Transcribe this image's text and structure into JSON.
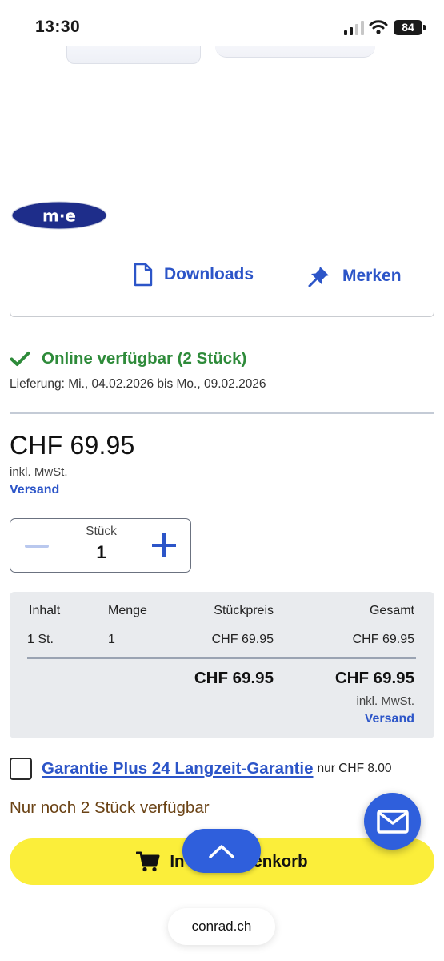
{
  "status_bar": {
    "time": "13:30",
    "battery": "84"
  },
  "product_card": {
    "brand_logo_icon": "m-e-logo",
    "downloads_label": "Downloads",
    "merken_label": "Merken"
  },
  "availability": {
    "status": "Online verfügbar (2 Stück)",
    "delivery": "Lieferung: Mi., 04.02.2026 bis Mo., 09.02.2026"
  },
  "price": {
    "amount": "CHF 69.95",
    "vat_note": "inkl. MwSt.",
    "shipping_link": "Versand"
  },
  "quantity": {
    "label": "Stück",
    "value": "1"
  },
  "price_table": {
    "headers": [
      "Inhalt",
      "Menge",
      "Stückpreis",
      "Gesamt"
    ],
    "rows": [
      [
        "1 St.",
        "1",
        "CHF 69.95",
        "CHF 69.95"
      ]
    ],
    "total_unit": "CHF 69.95",
    "total_sum": "CHF 69.95",
    "vat_note": "inkl. MwSt.",
    "shipping_link": "Versand"
  },
  "guarantee": {
    "label": "Garantie Plus 24 Langzeit-Garantie",
    "price": "nur CHF 8.00"
  },
  "stock_warning": "Nur noch 2 Stück verfügbar",
  "cart_button": {
    "label": "In den Warenkorb"
  },
  "browser": {
    "url": "conrad.ch"
  },
  "colors": {
    "accent_blue": "#2c55c8",
    "fab_blue": "#2f5fdc",
    "available_green": "#2e8b3a",
    "cart_yellow": "#fbee3a",
    "warning_brown": "#6a4214"
  }
}
